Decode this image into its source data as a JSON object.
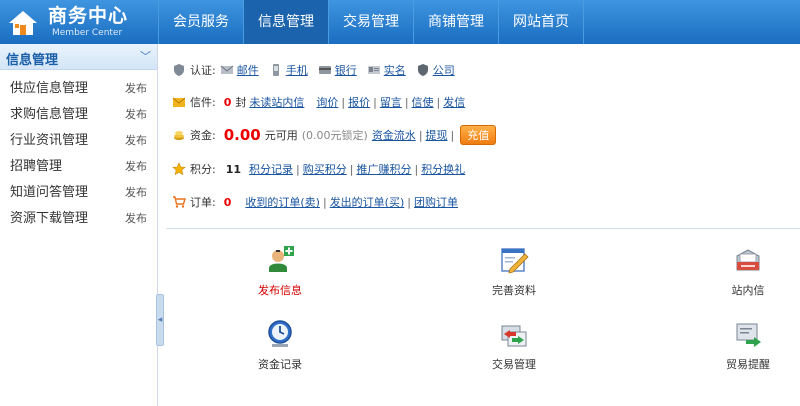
{
  "header": {
    "logo_title": "商务中心",
    "logo_subtitle": "Member Center",
    "nav": [
      {
        "label": "会员服务"
      },
      {
        "label": "信息管理"
      },
      {
        "label": "交易管理"
      },
      {
        "label": "商铺管理"
      },
      {
        "label": "网站首页"
      }
    ]
  },
  "sidebar": {
    "title": "信息管理",
    "items": [
      {
        "label": "供应信息管理",
        "action": "发布"
      },
      {
        "label": "求购信息管理",
        "action": "发布"
      },
      {
        "label": "行业资讯管理",
        "action": "发布"
      },
      {
        "label": "招聘管理",
        "action": "发布"
      },
      {
        "label": "知道问答管理",
        "action": "发布"
      },
      {
        "label": "资源下载管理",
        "action": "发布"
      }
    ]
  },
  "info": {
    "cert": {
      "label": "认证:",
      "items": [
        "邮件",
        "手机",
        "银行",
        "实名",
        "公司"
      ]
    },
    "mail": {
      "label": "信件:",
      "count": "0",
      "unit": "封",
      "unread_link": "未读站内信",
      "links": [
        "询价",
        "报价",
        "留言",
        "信使",
        "发信"
      ]
    },
    "funds": {
      "label": "资金:",
      "amount": "0.00",
      "available": "元可用",
      "locked": "(0.00元锁定)",
      "links": [
        "资金流水",
        "提现"
      ],
      "recharge": "充值"
    },
    "points": {
      "label": "积分:",
      "value": "11",
      "links": [
        "积分记录",
        "购买积分",
        "推广赚积分",
        "积分换礼"
      ]
    },
    "orders": {
      "label": "订单:",
      "count": "0",
      "links": [
        "收到的订单(卖)",
        "发出的订单(买)",
        "团购订单"
      ]
    }
  },
  "tiles": [
    {
      "label": "发布信息",
      "icon": "publish-user-icon"
    },
    {
      "label": "完善资料",
      "icon": "edit-profile-icon"
    },
    {
      "label": "站内信",
      "icon": "mailbox-icon"
    },
    {
      "label": "资金记录",
      "icon": "clock-icon"
    },
    {
      "label": "交易管理",
      "icon": "trade-icon"
    },
    {
      "label": "贸易提醒",
      "icon": "reminder-icon"
    }
  ],
  "colors": {
    "header_blue": "#1a6dc0",
    "active_nav": "#1b63ad",
    "alert_red": "#e00000",
    "link_blue": "#1a55a0",
    "recharge_orange": "#f07d10"
  }
}
